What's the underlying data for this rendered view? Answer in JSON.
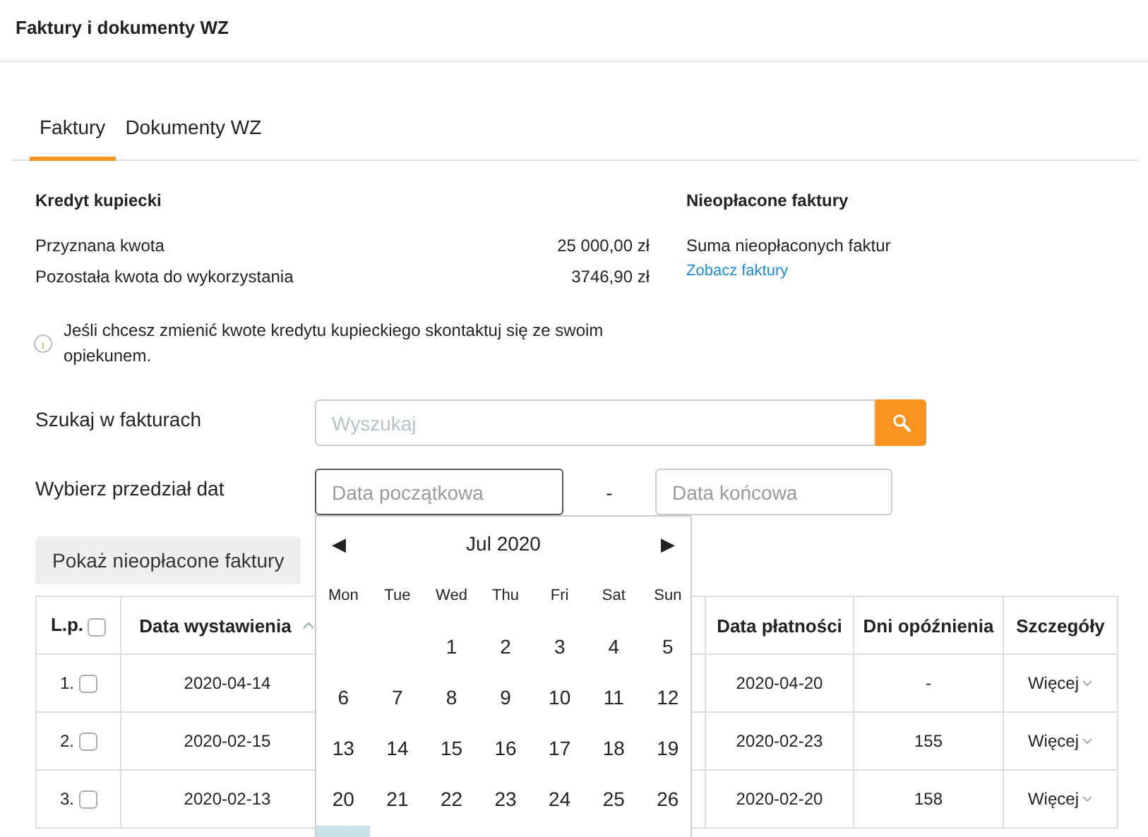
{
  "window": {
    "title": "Faktury i dokumenty WZ"
  },
  "tabs": [
    {
      "label": "Faktury",
      "selected": true
    },
    {
      "label": "Dokumenty WZ",
      "selected": false
    }
  ],
  "credit": {
    "title": "Kredyt kupiecki",
    "rows": [
      {
        "label": "Przyznana kwota",
        "value": "25 000,00 zł"
      },
      {
        "label": "Pozostała kwota do wykorzystania",
        "value": "3746,90 zł"
      }
    ],
    "info": "Jeśli chcesz zmienić kwote kredytu kupieckiego skontaktuj się ze swoim opiekunem."
  },
  "unpaid": {
    "title": "Nieopłacone faktury",
    "label": "Suma nieopłaconych faktur",
    "link": "Zobacz faktury"
  },
  "search": {
    "label": "Szukaj w fakturach",
    "placeholder": "Wyszukaj"
  },
  "date_range": {
    "label": "Wybierz przedział dat",
    "start_placeholder": "Data początkowa",
    "start_focused": true,
    "separator": "-",
    "end_placeholder": "Data końcowa"
  },
  "calendar": {
    "prev": "◀",
    "month": "Jul 2020",
    "next": "▶",
    "weekdays": [
      "Mon",
      "Tue",
      "Wed",
      "Thu",
      "Fri",
      "Sat",
      "Sun"
    ],
    "weeks": [
      [
        "1",
        "2",
        "3",
        "4",
        "5"
      ],
      [
        "6",
        "7",
        "8",
        "9",
        "10",
        "11",
        "12"
      ],
      [
        "13",
        "14",
        "15",
        "16",
        "17",
        "18",
        "19"
      ],
      [
        "20",
        "21",
        "22",
        "23",
        "24",
        "25",
        "26"
      ]
    ],
    "cut_row_highlight": true
  },
  "unpaid_button": "Pokaż nieopłacone faktury",
  "table": {
    "select_all_checked": false,
    "columns": [
      {
        "kind": "index",
        "label": "L.p."
      },
      {
        "kind": "text",
        "label": "Data wystawienia",
        "sorted": true
      },
      {
        "kind": "text",
        "label": "Data płatności",
        "sorted": false
      },
      {
        "kind": "text",
        "label": "Dni opóźnienia",
        "sorted": false
      },
      {
        "kind": "details",
        "label": "Szczegóły"
      }
    ],
    "rows": [
      {
        "checked": false,
        "cells": [
          "1.",
          "2020-04-14",
          "2020-04-20",
          "-",
          "Więcej"
        ]
      },
      {
        "checked": false,
        "cells": [
          "2.",
          "2020-02-15",
          "2020-02-23",
          "155",
          "Więcej"
        ]
      },
      {
        "checked": false,
        "cells": [
          "3.",
          "2020-02-13",
          "2020-02-20",
          "158",
          "Więcej"
        ]
      }
    ]
  }
}
